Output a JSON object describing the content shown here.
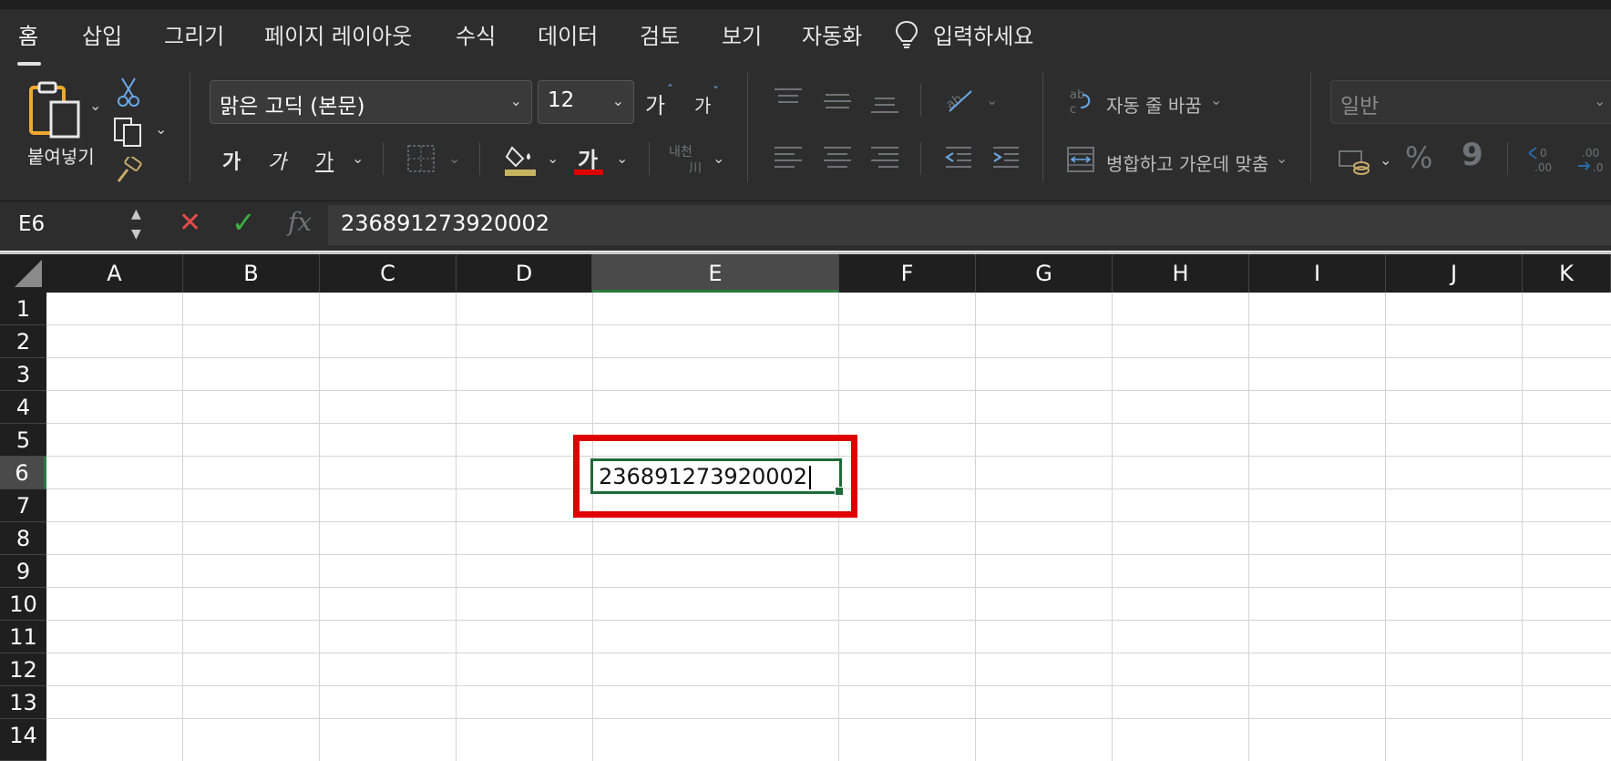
{
  "ribbon": {
    "tabs": [
      "홈",
      "삽입",
      "그리기",
      "페이지 레이아웃",
      "수식",
      "데이터",
      "검토",
      "보기",
      "자동화"
    ],
    "active_tab": "홈",
    "tell_me": "입력하세요",
    "clipboard": {
      "paste_label": "붙여넣기"
    },
    "font": {
      "name": "맑은 고딕 (본문)",
      "size": "12",
      "grow_label": "가",
      "shrink_label": "가",
      "bold_label": "가",
      "italic_label": "가",
      "underline_label": "가",
      "font_color_label": "가",
      "font_color": "#e00000",
      "fill_color": "#c8b560",
      "phonetic_label": "내천"
    },
    "alignment": {
      "wrap_text": "자동 줄 바꿈",
      "merge_center": "병합하고 가운데 맞춤"
    },
    "number": {
      "format": "일반",
      "percent": "%",
      "comma": "9"
    }
  },
  "formula_bar": {
    "name_box": "E6",
    "fx_label": "fx",
    "content": "236891273920002"
  },
  "sheet": {
    "columns": [
      "A",
      "B",
      "C",
      "D",
      "E",
      "F",
      "G",
      "H",
      "I",
      "J",
      "K"
    ],
    "rows": [
      "1",
      "2",
      "3",
      "4",
      "5",
      "6",
      "7",
      "8",
      "9",
      "10",
      "11",
      "12",
      "13",
      "14"
    ],
    "selected_column": "E",
    "selected_row": "6",
    "active_cell_value": "236891273920002"
  },
  "colors": {
    "accent_green": "#1e6b38",
    "highlight_red": "#e00000"
  }
}
